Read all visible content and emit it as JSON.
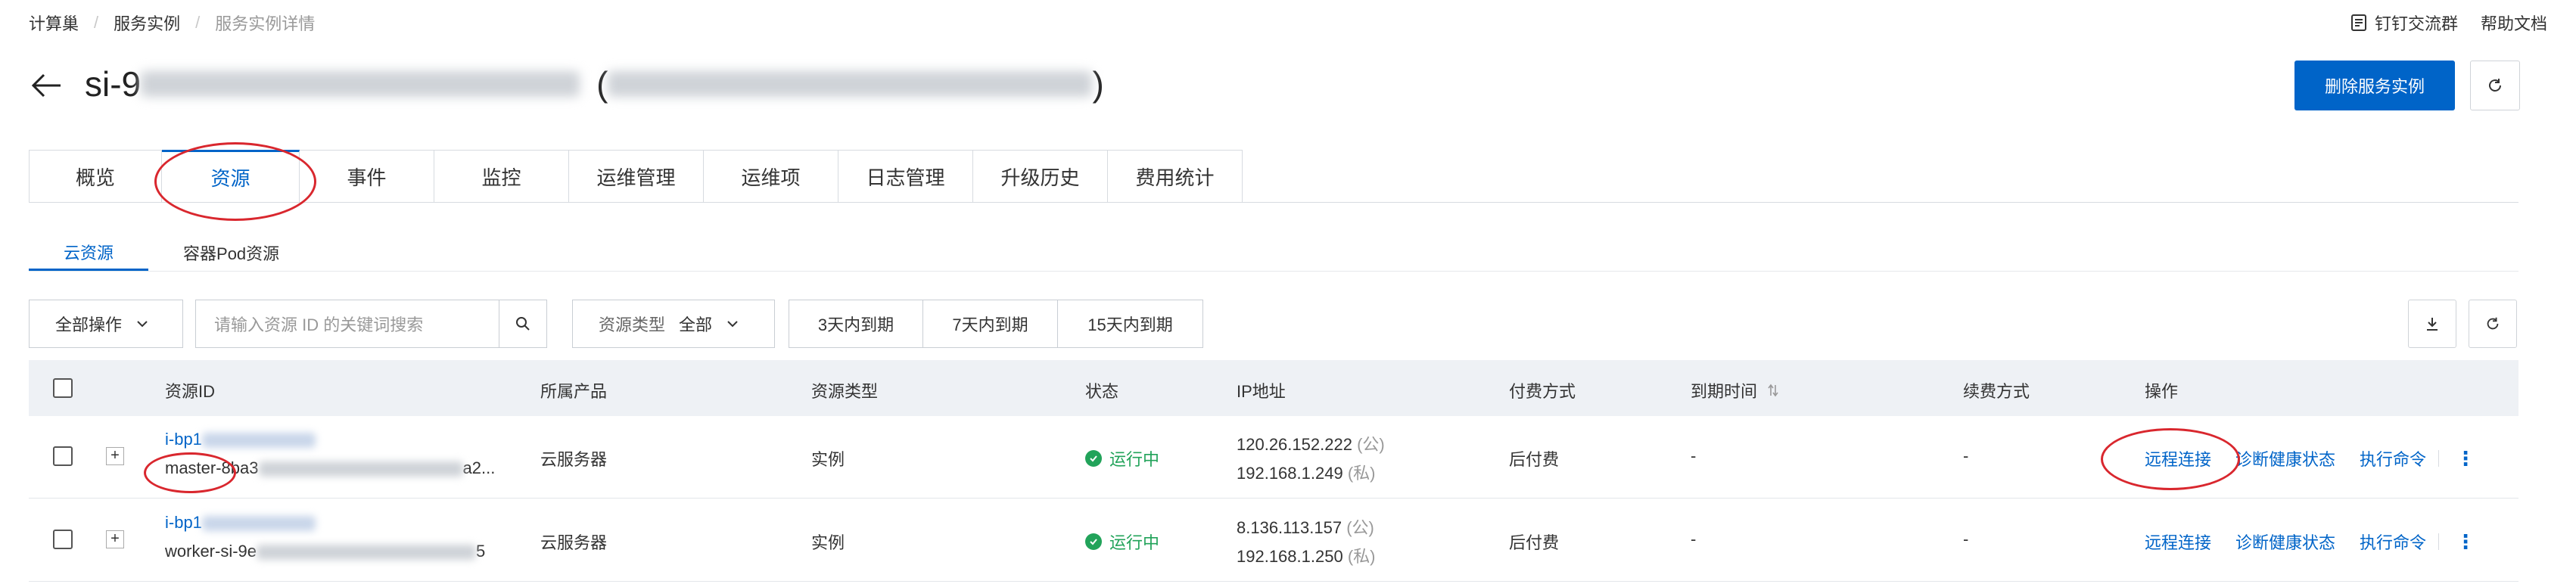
{
  "breadcrumb": {
    "items": [
      "计算巢",
      "服务实例",
      "服务实例详情"
    ]
  },
  "top_links": {
    "dingtalk": "钉钉交流群",
    "help": "帮助文档"
  },
  "header": {
    "title_prefix": "si-9",
    "title_paren": "(",
    "title_close": ")"
  },
  "actions": {
    "delete_label": "删除服务实例"
  },
  "tabs": [
    "概览",
    "资源",
    "事件",
    "监控",
    "运维管理",
    "运维项",
    "日志管理",
    "升级历史",
    "费用统计"
  ],
  "subtabs": [
    "云资源",
    "容器Pod资源"
  ],
  "toolbar": {
    "all_ops": "全部操作",
    "search_placeholder": "请输入资源 ID 的关键词搜索",
    "resource_type_label": "资源类型",
    "resource_type_value": "全部",
    "days": [
      "3天内到期",
      "7天内到期",
      "15天内到期"
    ]
  },
  "table": {
    "columns": [
      "资源ID",
      "所属产品",
      "资源类型",
      "状态",
      "IP地址",
      "付费方式",
      "到期时间",
      "续费方式",
      "操作"
    ],
    "rows": [
      {
        "id": "i-bp1",
        "name_prefix": "master-8ba3",
        "name_suffix": "a2...",
        "product": "云服务器",
        "type": "实例",
        "status": "运行中",
        "ip_public": "120.26.152.222",
        "ip_public_tag": "(公)",
        "ip_private": "192.168.1.249",
        "ip_private_tag": "(私)",
        "billing": "后付费",
        "expire": "-",
        "renew": "-",
        "ops": [
          "远程连接",
          "诊断健康状态",
          "执行命令"
        ]
      },
      {
        "id": "i-bp1",
        "name_prefix": "worker-si-9e",
        "name_suffix": "5",
        "product": "云服务器",
        "type": "实例",
        "status": "运行中",
        "ip_public": "8.136.113.157",
        "ip_public_tag": "(公)",
        "ip_private": "192.168.1.250",
        "ip_private_tag": "(私)",
        "billing": "后付费",
        "expire": "-",
        "renew": "-",
        "ops": [
          "远程连接",
          "诊断健康状态",
          "执行命令"
        ]
      }
    ]
  },
  "colors": {
    "primary": "#0064c8",
    "success": "#22a35a",
    "annotation": "#d9272e"
  }
}
